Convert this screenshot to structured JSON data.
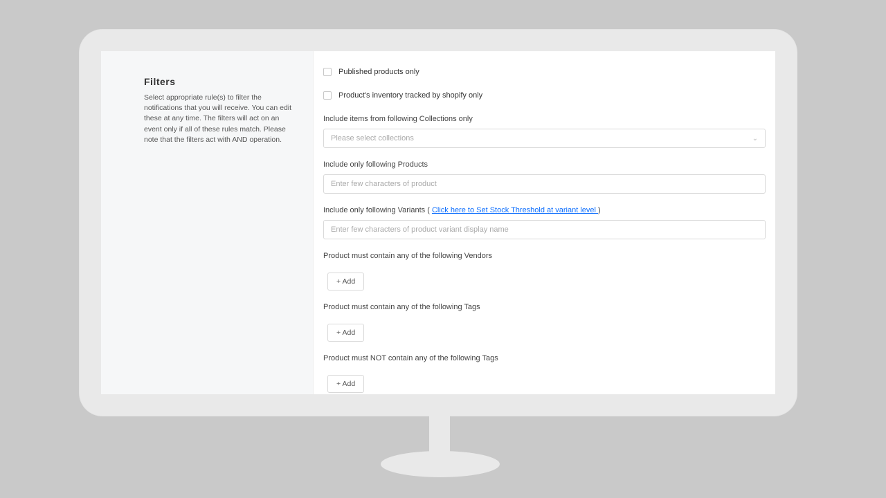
{
  "sidebar": {
    "title": "Filters",
    "description": "Select appropriate rule(s) to filter the notifications that you will receive. You can edit these at any time. The filters will act on an event only if all of these rules match. Please note that the filters act with AND operation."
  },
  "checks": {
    "published": "Published products only",
    "tracked": "Product's inventory tracked by shopify only"
  },
  "collections": {
    "label": "Include items from following Collections only",
    "placeholder": "Please select collections"
  },
  "products": {
    "label": "Include only following Products",
    "placeholder": "Enter few characters of product"
  },
  "variants": {
    "label_prefix": "Include only following Variants ( ",
    "link_text": "Click here to Set Stock Threshold at variant level ",
    "label_suffix": ")",
    "placeholder": "Enter few characters of product variant display name"
  },
  "vendors": {
    "label": "Product must contain any of the following Vendors",
    "add": "+ Add"
  },
  "tags_include": {
    "label": "Product must contain any of the following Tags",
    "add": "+ Add"
  },
  "tags_exclude": {
    "label": "Product must NOT contain any of the following Tags",
    "add": "+ Add"
  }
}
